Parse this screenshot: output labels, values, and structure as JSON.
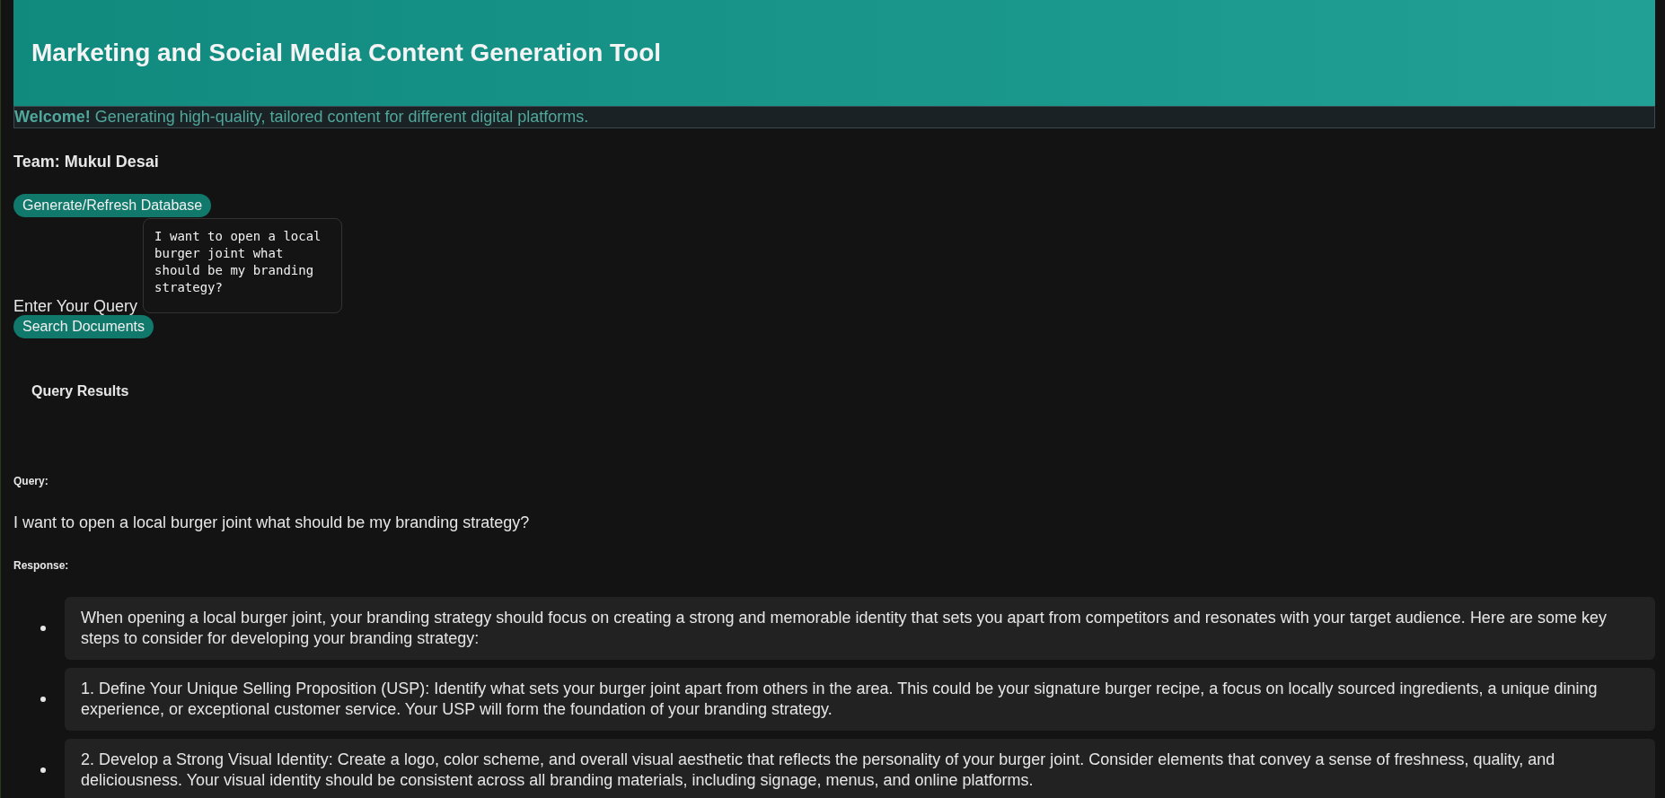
{
  "header": {
    "title": "Marketing and Social Media Content Generation Tool"
  },
  "welcome": {
    "text": "**Welcome!** Generating high-quality, tailored content for different digital platforms."
  },
  "team": "Team: Mukul Desai",
  "generate_button": "Generate/Refresh Database",
  "query_field": {
    "label": "Enter Your Query",
    "value": "I want to open a local burger joint what should be my branding strategy?"
  },
  "search_button": "Search Documents",
  "results": {
    "title": "Query Results",
    "query_label": "Query:",
    "query": "I want to open a local burger joint what should be my branding strategy?",
    "response_label": "Response:",
    "items": [
      {
        "text": "When opening a local burger joint, your branding strategy should focus on creating a strong and memorable identity that sets you apart from competitors and resonates with your target audience. Here are some key steps to consider for developing your branding strategy:"
      },
      {
        "text": "1. Define Your Unique Selling Proposition (USP): Identify what sets your burger joint apart from others in the area. This could be your signature burger recipe, a focus on locally sourced ingredients, a unique dining experience, or exceptional customer service. Your USP will form the foundation of your branding strategy."
      },
      {
        "text": "2. Develop a Strong Visual Identity: Create a logo, color scheme, and overall visual aesthetic that reflects the personality of your burger joint. Consider elements that convey a sense of freshness, quality, and deliciousness. Your visual identity should be consistent across all branding materials, including signage, menus, and online platforms."
      }
    ]
  }
}
